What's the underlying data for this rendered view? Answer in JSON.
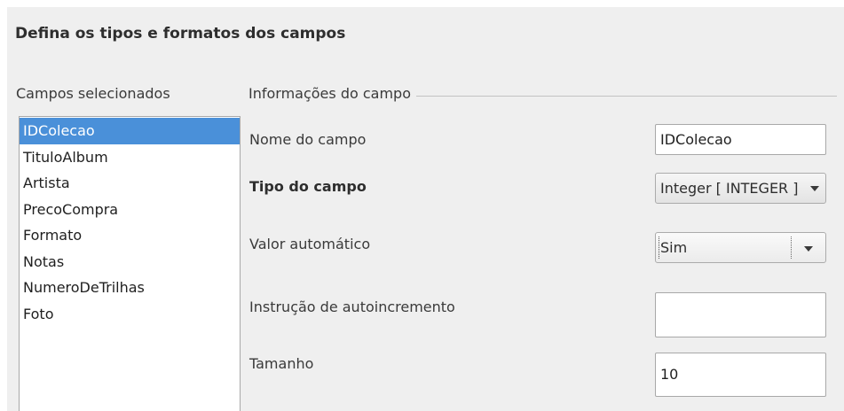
{
  "heading": "Defina os tipos e formatos dos campos",
  "selected_fields": {
    "label": "Campos selecionados",
    "items": [
      "IDColecao",
      "TituloAlbum",
      "Artista",
      "PrecoCompra",
      "Formato",
      "Notas",
      "NumeroDeTrilhas",
      "Foto"
    ],
    "selected": "IDColecao"
  },
  "field_info": {
    "title": "Informações do campo",
    "field_name": {
      "label": "Nome do campo",
      "value": "IDColecao"
    },
    "field_type": {
      "label": "Tipo do campo",
      "value": "Integer [ INTEGER ]"
    },
    "auto_value": {
      "label": "Valor automático",
      "value": "Sim"
    },
    "autoincrement": {
      "label": "Instrução de autoincremento",
      "value": ""
    },
    "length": {
      "label": "Tamanho",
      "value": "10"
    }
  },
  "colors": {
    "selection": "#4a90d9",
    "panel": "#efefef"
  },
  "icons": {
    "dropdown_arrow": "chevron-down-icon"
  }
}
